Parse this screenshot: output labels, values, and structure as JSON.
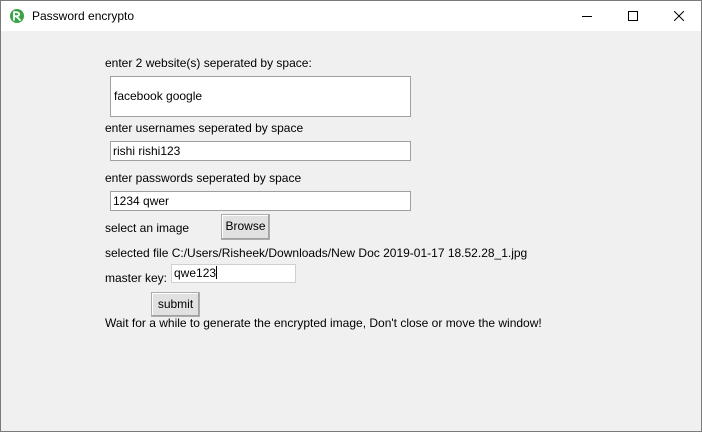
{
  "window": {
    "title": "Password encrypto",
    "icon": "python-feather-icon",
    "controls": [
      "minimize-icon",
      "maximize-icon",
      "close-icon"
    ]
  },
  "form": {
    "websites_label": "enter 2 website(s) seperated by space:",
    "websites_value": "facebook google",
    "usernames_label": "enter usernames seperated by space",
    "usernames_value": "rishi rishi123",
    "passwords_label": "enter passwords seperated by space",
    "passwords_value": "1234 qwer",
    "image_label": "select an image",
    "browse_label": "Browse",
    "selected_file": "selected file C:/Users/Risheek/Downloads/New Doc 2019-01-17 18.52.28_1.jpg",
    "master_key_label": "master key:",
    "master_key_value": "qwe123",
    "submit_label": "submit",
    "status_message": "Wait for a while to generate the encrypted image, Don't close or move the window!"
  }
}
